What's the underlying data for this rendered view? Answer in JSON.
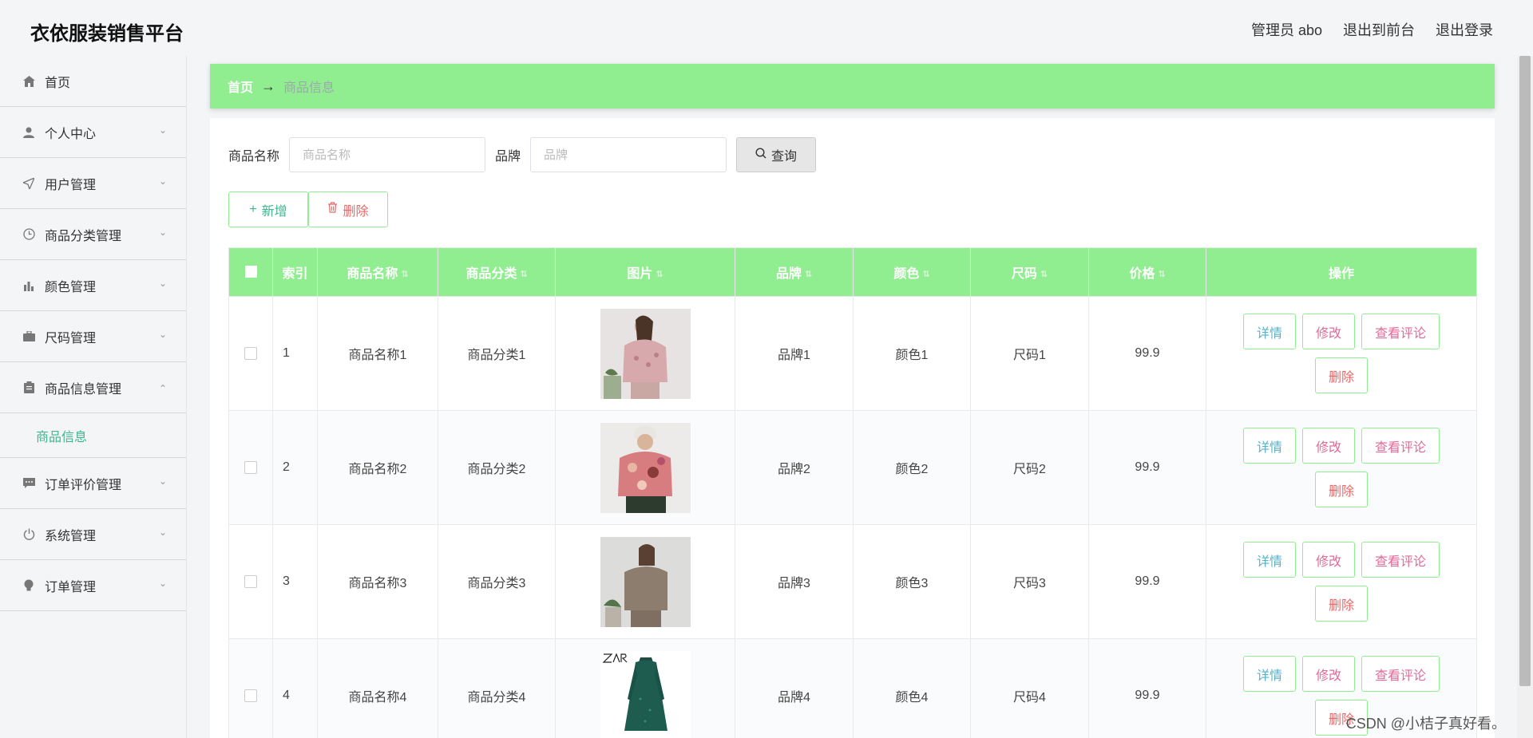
{
  "header": {
    "app_title": "衣依服装销售平台",
    "admin_label": "管理员 abo",
    "to_frontend": "退出到前台",
    "logout": "退出登录"
  },
  "sidebar": {
    "items": [
      {
        "label": "首页",
        "icon": "home-icon"
      },
      {
        "label": "个人中心",
        "icon": "user-icon"
      },
      {
        "label": "用户管理",
        "icon": "send-icon"
      },
      {
        "label": "商品分类管理",
        "icon": "clock-icon"
      },
      {
        "label": "颜色管理",
        "icon": "bar-chart-icon"
      },
      {
        "label": "尺码管理",
        "icon": "briefcase-icon"
      },
      {
        "label": "商品信息管理",
        "icon": "clipboard-icon"
      },
      {
        "label": "订单评价管理",
        "icon": "chat-icon"
      },
      {
        "label": "系统管理",
        "icon": "power-icon"
      },
      {
        "label": "订单管理",
        "icon": "bulb-icon"
      }
    ],
    "sub_item": "商品信息"
  },
  "breadcrumb": {
    "home": "首页",
    "arrow": "→",
    "current": "商品信息"
  },
  "search": {
    "name_label": "商品名称",
    "name_placeholder": "商品名称",
    "brand_label": "品牌",
    "brand_placeholder": "品牌",
    "query_button": "查询"
  },
  "actions": {
    "add": "新增",
    "delete": "删除"
  },
  "table": {
    "columns": [
      "索引",
      "商品名称",
      "商品分类",
      "图片",
      "品牌",
      "颜色",
      "尺码",
      "价格",
      "操作"
    ],
    "rows": [
      {
        "index": "1",
        "name": "商品名称1",
        "category": "商品分类1",
        "brand": "品牌1",
        "color": "颜色1",
        "size": "尺码1",
        "price": "99.9"
      },
      {
        "index": "2",
        "name": "商品名称2",
        "category": "商品分类2",
        "brand": "品牌2",
        "color": "颜色2",
        "size": "尺码2",
        "price": "99.9"
      },
      {
        "index": "3",
        "name": "商品名称3",
        "category": "商品分类3",
        "brand": "品牌3",
        "color": "颜色3",
        "size": "尺码3",
        "price": "99.9"
      },
      {
        "index": "4",
        "name": "商品名称4",
        "category": "商品分类4",
        "brand": "品牌4",
        "color": "颜色4",
        "size": "尺码4",
        "price": "99.9"
      }
    ],
    "row_actions": {
      "detail": "详情",
      "edit": "修改",
      "review": "查看评论",
      "delete": "删除"
    }
  },
  "watermark": "CSDN @小桔子真好看。",
  "colors": {
    "accent_green": "#90ee90",
    "active_text": "#3fb58e",
    "danger_text": "#e26a6a"
  }
}
